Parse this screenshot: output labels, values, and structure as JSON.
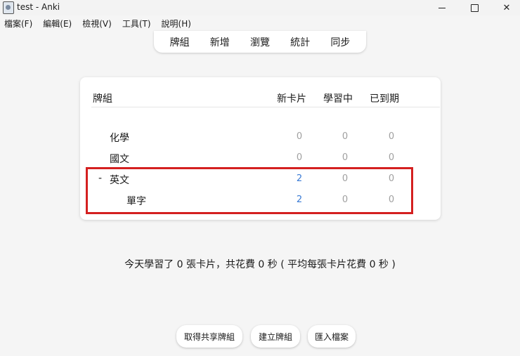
{
  "window": {
    "title": "test - Anki"
  },
  "menu": [
    "檔案(F)",
    "編輯(E)",
    "檢視(V)",
    "工具(T)",
    "說明(H)"
  ],
  "toolbar": [
    "牌組",
    "新增",
    "瀏覽",
    "統計",
    "同步"
  ],
  "deck_table": {
    "headers": {
      "deck": "牌組",
      "new": "新卡片",
      "learn": "學習中",
      "due": "已到期"
    },
    "rows": [
      {
        "name": "化學",
        "new": "0",
        "learn": "0",
        "due": "0",
        "collapse": ""
      },
      {
        "name": "國文",
        "new": "0",
        "learn": "0",
        "due": "0",
        "collapse": ""
      },
      {
        "name": "英文",
        "new": "2",
        "learn": "0",
        "due": "0",
        "collapse": "-"
      },
      {
        "name": "單字",
        "new": "2",
        "learn": "0",
        "due": "0",
        "collapse": ""
      }
    ]
  },
  "stats_text": "今天學習了 0 張卡片，共花費 0 秒 ( 平均每張卡片花費 0 秒 )",
  "buttons": {
    "shared": "取得共享牌組",
    "create": "建立牌組",
    "import": "匯入檔案"
  },
  "colors": {
    "accent_blue": "#3a7bd5",
    "highlight_red": "#d42020",
    "zero_gray": "#a0a0a0"
  }
}
